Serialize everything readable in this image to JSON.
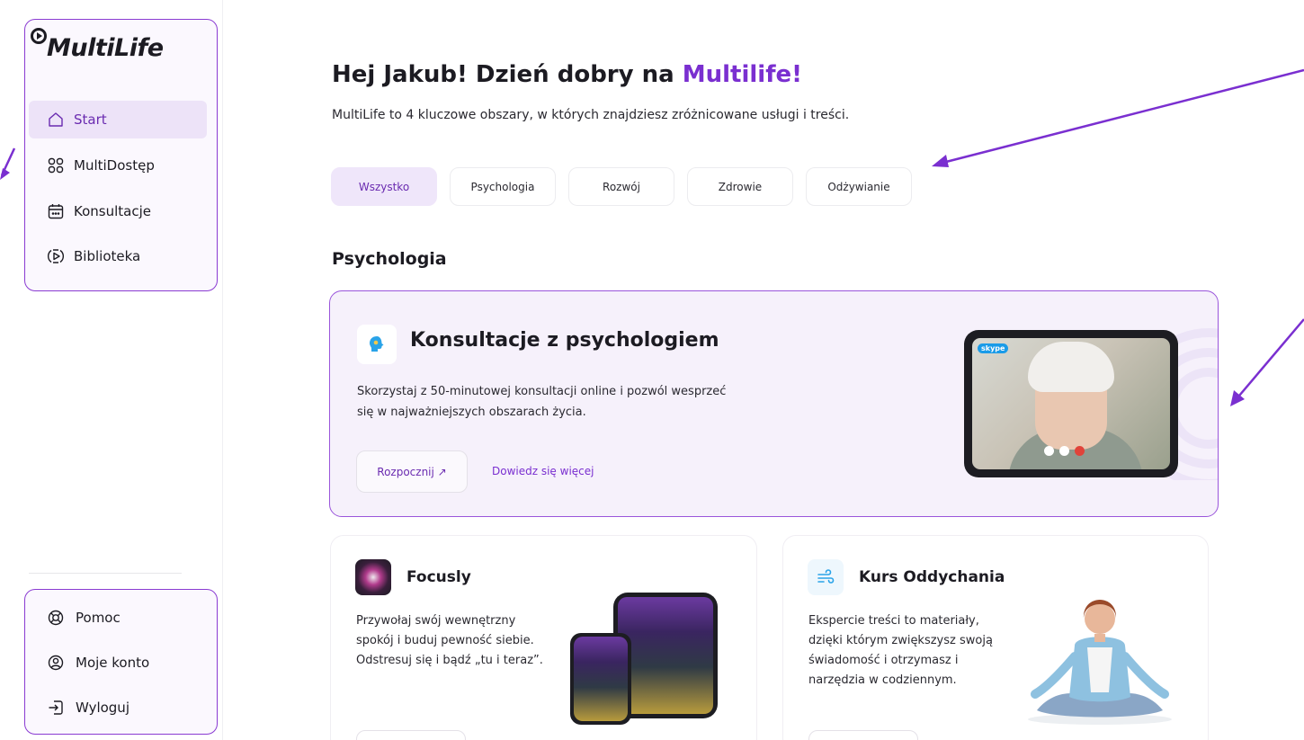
{
  "sidebar": {
    "logo": "MultiLife",
    "nav": [
      {
        "label": "Start",
        "icon": "home-icon",
        "active": true
      },
      {
        "label": "MultiDostęp",
        "icon": "grid-icon",
        "active": false
      },
      {
        "label": "Konsultacje",
        "icon": "calendar-icon",
        "active": false
      },
      {
        "label": "Biblioteka",
        "icon": "play-circle-icon",
        "active": false
      }
    ],
    "bottom": [
      {
        "label": "Pomoc",
        "icon": "lifebuoy-icon"
      },
      {
        "label": "Moje konto",
        "icon": "user-icon"
      },
      {
        "label": "Wyloguj",
        "icon": "logout-icon"
      }
    ]
  },
  "header": {
    "greeting": "Hej Jakub! Dzień dobry na ",
    "greeting_highlight": "Multilife!",
    "subtitle": "MultiLife to 4 kluczowe obszary, w których znajdziesz zróżnicowane usługi i treści."
  },
  "tabs": [
    {
      "label": "Wszystko",
      "active": true
    },
    {
      "label": "Psychologia",
      "active": false
    },
    {
      "label": "Rozwój",
      "active": false
    },
    {
      "label": "Zdrowie",
      "active": false
    },
    {
      "label": "Odżywianie",
      "active": false
    }
  ],
  "section_title": "Psychologia",
  "hero": {
    "title": "Konsultacje z psychologiem",
    "description": "Skorzystaj z 50-minutowej konsultacji online i pozwól wesprzeć się w najważniejszych obszarach życia.",
    "start_button": "Rozpocznij ↗",
    "more_link": "Dowiedz się więcej",
    "skype_label": "skype"
  },
  "cards": [
    {
      "title": "Focusly",
      "description": "Przywołaj swój wewnętrzny spokój i buduj pewność siebie. Odstresuj się i bądź „tu i teraz”."
    },
    {
      "title": "Kurs Oddychania",
      "description": "Ekspercie treści to materiały, dzięki którym zwiększysz swoją świadomość i otrzymasz i narzędzia w codziennym."
    }
  ],
  "colors": {
    "accent": "#7a2fd0",
    "border": "#8a3bd2",
    "active_bg": "#ede3f8"
  }
}
